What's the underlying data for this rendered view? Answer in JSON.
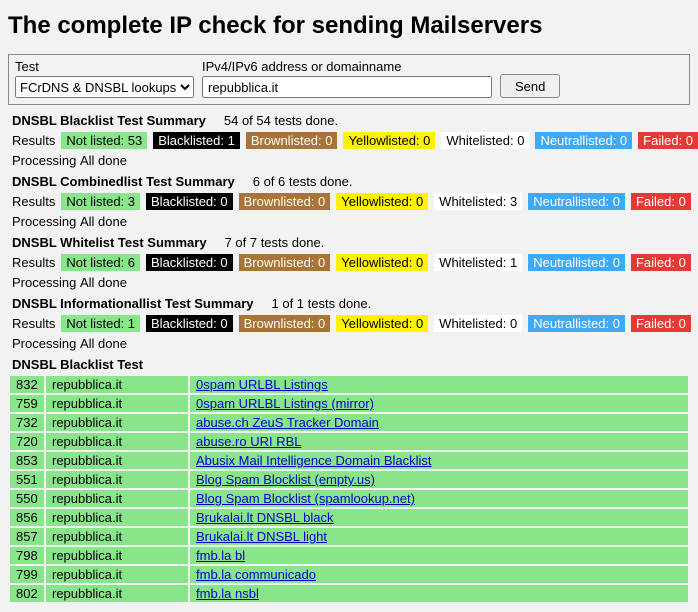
{
  "title": "The complete IP check for sending Mailservers",
  "form": {
    "test_label": "Test",
    "test_value": "FCrDNS & DNSBL lookups",
    "addr_label": "IPv4/IPv6 address or domainname",
    "addr_value": "repubblica.it",
    "send_label": "Send"
  },
  "summaries": [
    {
      "title": "DNSBL Blacklist Test Summary",
      "status": "54 of 54 tests done.",
      "results_label": "Results",
      "processing_label": "Processing",
      "processing_value": "All done",
      "badges": {
        "notlisted": "Not listed: 53",
        "black": "Blacklisted: 1",
        "brown": "Brownlisted: 0",
        "yellow": "Yellowlisted: 0",
        "white": "Whitelisted: 0",
        "neutral": "Neutrallisted: 0",
        "failed": "Failed: 0"
      }
    },
    {
      "title": "DNSBL Combinedlist Test Summary",
      "status": "6 of 6 tests done.",
      "results_label": "Results",
      "processing_label": "Processing",
      "processing_value": "All done",
      "badges": {
        "notlisted": "Not listed: 3",
        "black": "Blacklisted: 0",
        "brown": "Brownlisted: 0",
        "yellow": "Yellowlisted: 0",
        "white": "Whitelisted: 3",
        "neutral": "Neutrallisted: 0",
        "failed": "Failed: 0"
      }
    },
    {
      "title": "DNSBL Whitelist Test Summary",
      "status": "7 of 7 tests done.",
      "results_label": "Results",
      "processing_label": "Processing",
      "processing_value": "All done",
      "badges": {
        "notlisted": "Not listed: 6",
        "black": "Blacklisted: 0",
        "brown": "Brownlisted: 0",
        "yellow": "Yellowlisted: 0",
        "white": "Whitelisted: 1",
        "neutral": "Neutrallisted: 0",
        "failed": "Failed: 0"
      }
    },
    {
      "title": "DNSBL Informationallist Test Summary",
      "status": "1 of 1 tests done.",
      "results_label": "Results",
      "processing_label": "Processing",
      "processing_value": "All done",
      "badges": {
        "notlisted": "Not listed: 1",
        "black": "Blacklisted: 0",
        "brown": "Brownlisted: 0",
        "yellow": "Yellowlisted: 0",
        "white": "Whitelisted: 0",
        "neutral": "Neutrallisted: 0",
        "failed": "Failed: 0"
      }
    }
  ],
  "detail": {
    "title": "DNSBL Blacklist Test",
    "host": "repubblica.it",
    "rows": [
      {
        "id": "832",
        "name": "0spam URLBL Listings"
      },
      {
        "id": "759",
        "name": "0spam URLBL Listings (mirror)"
      },
      {
        "id": "732",
        "name": "abuse.ch ZeuS Tracker Domain"
      },
      {
        "id": "720",
        "name": "abuse.ro URI RBL"
      },
      {
        "id": "853",
        "name": "Abusix Mail Intelligence Domain Blacklist"
      },
      {
        "id": "551",
        "name": "Blog Spam Blocklist (empty.us)"
      },
      {
        "id": "550",
        "name": "Blog Spam Blocklist (spamlookup.net)"
      },
      {
        "id": "856",
        "name": "Brukalai.lt DNSBL black"
      },
      {
        "id": "857",
        "name": "Brukalai.lt DNSBL light"
      },
      {
        "id": "798",
        "name": "fmb.la bl"
      },
      {
        "id": "799",
        "name": "fmb.la communicado"
      },
      {
        "id": "802",
        "name": "fmb.la nsbl"
      }
    ]
  }
}
